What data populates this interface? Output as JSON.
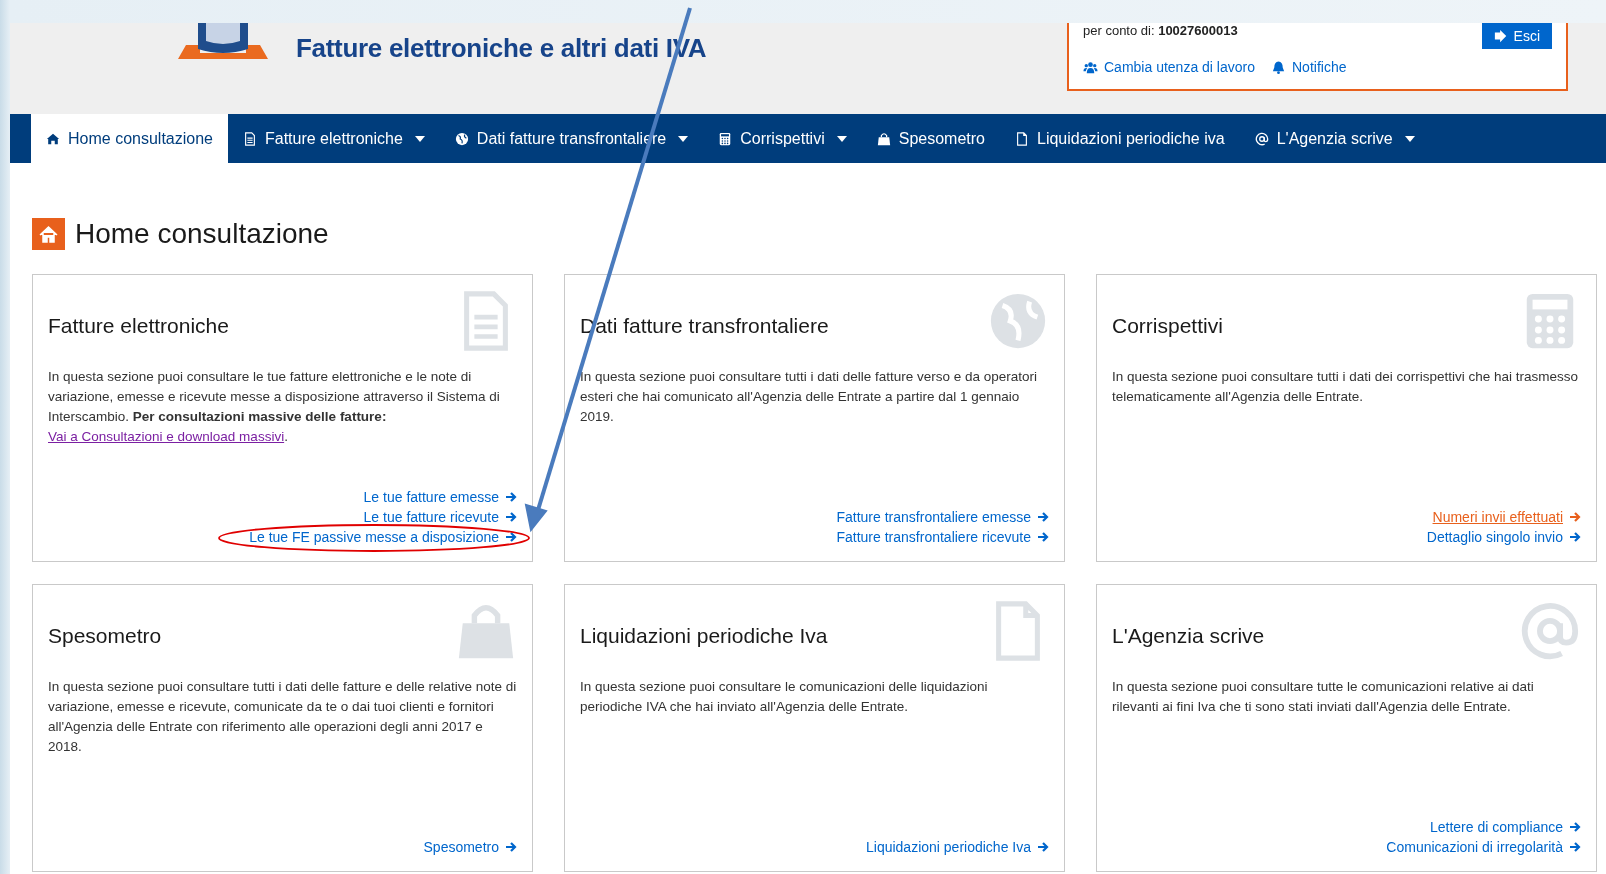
{
  "header": {
    "title": "Fatture elettroniche e altri dati IVA",
    "user_box": {
      "account": "per conto di: **10027600013**",
      "logout": "Esci",
      "links": [
        {
          "label": "Cambia utenza di lavoro"
        },
        {
          "label": "Notifiche"
        }
      ]
    }
  },
  "nav": [
    {
      "label": "Home consultazione",
      "selected": true,
      "dropdown": false
    },
    {
      "label": "Fatture elettroniche",
      "selected": false,
      "dropdown": true
    },
    {
      "label": "Dati fatture transfrontaliere",
      "selected": false,
      "dropdown": true
    },
    {
      "label": "Corrispettivi",
      "selected": false,
      "dropdown": true
    },
    {
      "label": "Spesometro",
      "selected": false,
      "dropdown": false
    },
    {
      "label": "Liquidazioni periodiche iva",
      "selected": false,
      "dropdown": false
    },
    {
      "label": "L'Agenzia scrive",
      "selected": false,
      "dropdown": true
    }
  ],
  "page_title": "Home consultazione",
  "cards": [
    {
      "title": "Fatture elettroniche",
      "text": "In questa sezione puoi consultare le tue fatture elettroniche e le note di variazione, emesse e ricevute messe a disposizione attraverso il Sistema di Interscambio. **Per consultazioni massive delle fatture:**",
      "inline_link": "Vai a Consultazioni e download massivi",
      "after_link": ".",
      "links": [
        {
          "label": "Le tue fatture emesse",
          "hovered": false
        },
        {
          "label": "Le tue fatture ricevute",
          "hovered": false
        },
        {
          "label": "Le tue FE passive messe a disposizione",
          "hovered": false
        }
      ]
    },
    {
      "title": "Dati fatture transfrontaliere",
      "text": "In questa sezione puoi consultare tutti i dati delle fatture verso e da operatori esteri che hai comunicato all'Agenzia delle Entrate a partire dal 1 gennaio 2019.",
      "links": [
        {
          "label": "Fatture transfrontaliere emesse",
          "hovered": false
        },
        {
          "label": "Fatture transfrontaliere ricevute",
          "hovered": false
        }
      ]
    },
    {
      "title": "Corrispettivi",
      "text": "In questa sezione puoi consultare tutti i dati dei corrispettivi che hai trasmesso telematicamente all'Agenzia delle Entrate.",
      "links": [
        {
          "label": "Numeri invii effettuati",
          "hovered": true
        },
        {
          "label": "Dettaglio singolo invio",
          "hovered": false
        }
      ]
    },
    {
      "title": "Spesometro",
      "text": "In questa sezione puoi consultare tutti i dati delle fatture e delle relative note di variazione, emesse e ricevute, comunicate da te o dai tuoi clienti e fornitori all'Agenzia delle Entrate con riferimento alle operazioni degli anni 2017 e 2018.",
      "links": [
        {
          "label": "Spesometro",
          "hovered": false
        }
      ]
    },
    {
      "title": "Liquidazioni periodiche Iva",
      "text": "In questa sezione puoi consultare le comunicazioni delle liquidazioni periodiche IVA che hai inviato all'Agenzia delle Entrate.",
      "links": [
        {
          "label": "Liquidazioni periodiche Iva",
          "hovered": false
        }
      ]
    },
    {
      "title": "L'Agenzia scrive",
      "text": "In questa sezione puoi consultare tutte le comunicazioni relative ai dati rilevanti ai fini Iva che ti sono stati inviati dall'Agenzia delle Entrate.",
      "links": [
        {
          "label": "Lettere di compliance",
          "hovered": false
        },
        {
          "label": "Comunicazioni di irregolarità",
          "hovered": false
        }
      ]
    }
  ]
}
